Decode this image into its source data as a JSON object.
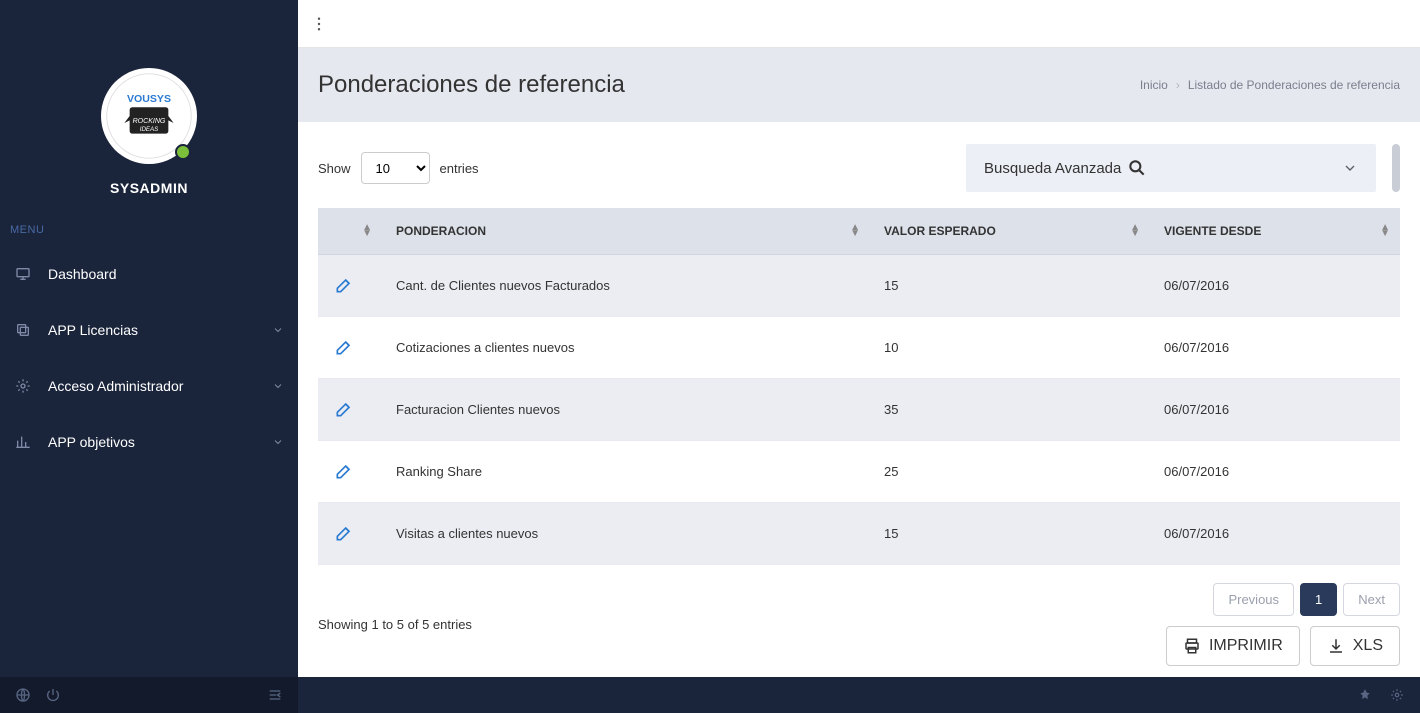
{
  "user": {
    "name": "SYSADMIN"
  },
  "menu_label": "MENU",
  "nav": [
    {
      "label": "Dashboard",
      "icon": "monitor",
      "expandable": false
    },
    {
      "label": "APP Licencias",
      "icon": "copy",
      "expandable": true
    },
    {
      "label": "Acceso Administrador",
      "icon": "gear",
      "expandable": true
    },
    {
      "label": "APP objetivos",
      "icon": "chart",
      "expandable": true
    }
  ],
  "page": {
    "title": "Ponderaciones de referencia",
    "breadcrumb_home": "Inicio",
    "breadcrumb_current": "Listado de Ponderaciones de referencia"
  },
  "table_controls": {
    "show_label": "Show",
    "entries_label": "entries",
    "page_size": "10",
    "advanced_search": "Busqueda Avanzada"
  },
  "columns": {
    "action": "",
    "ponderacion": "PONDERACION",
    "valor": "VALOR ESPERADO",
    "vigente": "VIGENTE DESDE"
  },
  "rows": [
    {
      "ponderacion": "Cant. de Clientes nuevos Facturados",
      "valor": "15",
      "vigente": "06/07/2016"
    },
    {
      "ponderacion": "Cotizaciones a clientes nuevos",
      "valor": "10",
      "vigente": "06/07/2016"
    },
    {
      "ponderacion": "Facturacion Clientes nuevos",
      "valor": "35",
      "vigente": "06/07/2016"
    },
    {
      "ponderacion": "Ranking Share",
      "valor": "25",
      "vigente": "06/07/2016"
    },
    {
      "ponderacion": "Visitas a clientes nuevos",
      "valor": "15",
      "vigente": "06/07/2016"
    }
  ],
  "footer": {
    "info": "Showing 1 to 5 of 5 entries",
    "prev": "Previous",
    "next": "Next",
    "page_current": "1",
    "print": "IMPRIMIR",
    "xls": "XLS"
  }
}
